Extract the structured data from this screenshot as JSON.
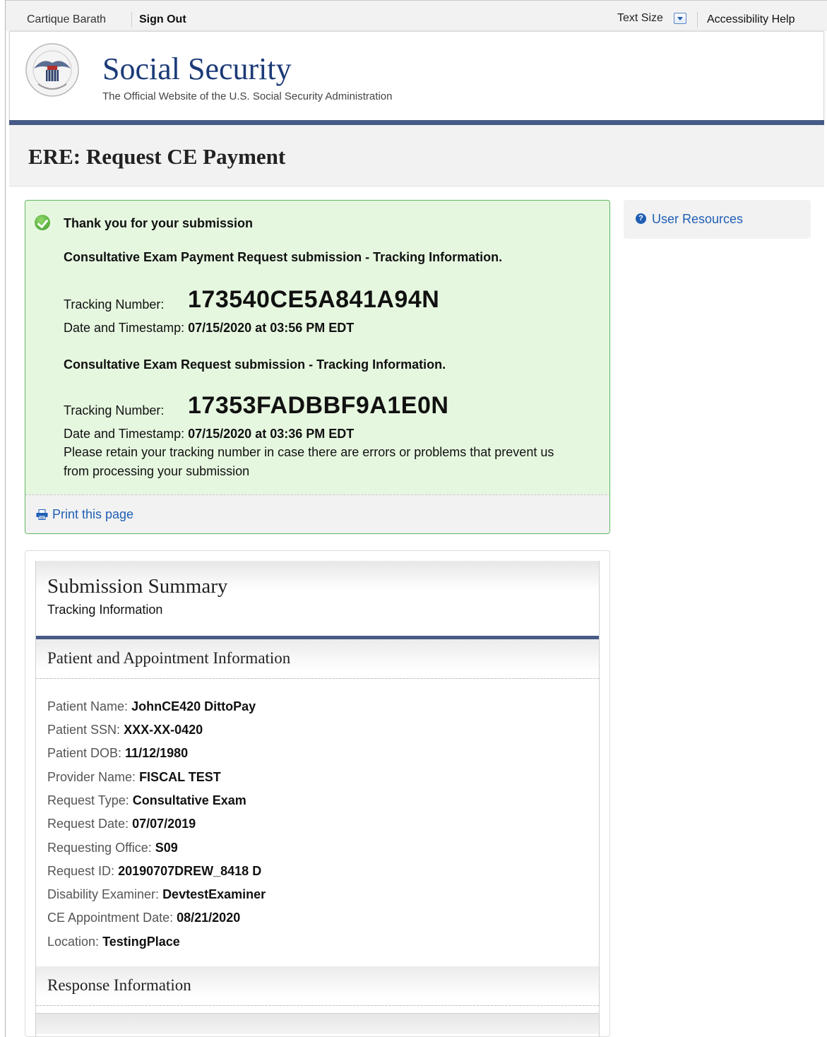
{
  "topbar": {
    "user_name": "Cartique Barath",
    "sign_out": "Sign Out",
    "text_size": "Text Size",
    "accessibility_help": "Accessibility Help"
  },
  "header": {
    "site_title": "Social Security",
    "site_subtitle": "The Official Website of the U.S. Social Security Administration",
    "seal_icon": "ssa-seal-icon"
  },
  "page": {
    "title": "ERE: Request CE Payment"
  },
  "success": {
    "heading": "Thank you for your submission",
    "payment_request_heading": "Consultative Exam Payment Request submission - Tracking Information.",
    "tracking_label": "Tracking Number:",
    "payment_tracking_number": "173540CE5A841A94N",
    "date_label": "Date and Timestamp:",
    "payment_timestamp": "07/15/2020 at 03:56 PM EDT",
    "exam_request_heading": "Consultative Exam Request submission - Tracking Information.",
    "exam_tracking_number": "17353FADBBF9A1E0N",
    "exam_timestamp": "07/15/2020 at 03:36 PM EDT",
    "retain_note_line1": "Please retain your tracking number in case there are errors or problems that prevent us",
    "retain_note_line2": "from processing your submission",
    "print_link": "Print this page",
    "success_color": "#5fb75f"
  },
  "sidebar": {
    "user_resources": "User Resources"
  },
  "summary": {
    "title": "Submission Summary",
    "subtitle": "Tracking Information",
    "section_patient": "Patient and Appointment Information",
    "fields": [
      {
        "label": "Patient Name:",
        "value": "JohnCE420 DittoPay"
      },
      {
        "label": "Patient SSN:",
        "value": "XXX-XX-0420"
      },
      {
        "label": "Patient DOB:",
        "value": "11/12/1980"
      },
      {
        "label": "Provider Name:",
        "value": "FISCAL TEST"
      },
      {
        "label": "Request Type:",
        "value": "Consultative Exam"
      },
      {
        "label": "Request Date:",
        "value": "07/07/2019"
      },
      {
        "label": "Requesting Office:",
        "value": "S09"
      },
      {
        "label": "Request ID:",
        "value": "20190707DREW_8418 D"
      },
      {
        "label": "Disability Examiner:",
        "value": "DevtestExaminer"
      },
      {
        "label": "CE Appointment Date:",
        "value": "08/21/2020"
      },
      {
        "label": "Location:",
        "value": "TestingPlace"
      }
    ],
    "section_response": "Response Information"
  },
  "colors": {
    "brand_blue": "#1b3a78",
    "rule_blue": "#465a86",
    "link_blue": "#1f5fb5"
  }
}
